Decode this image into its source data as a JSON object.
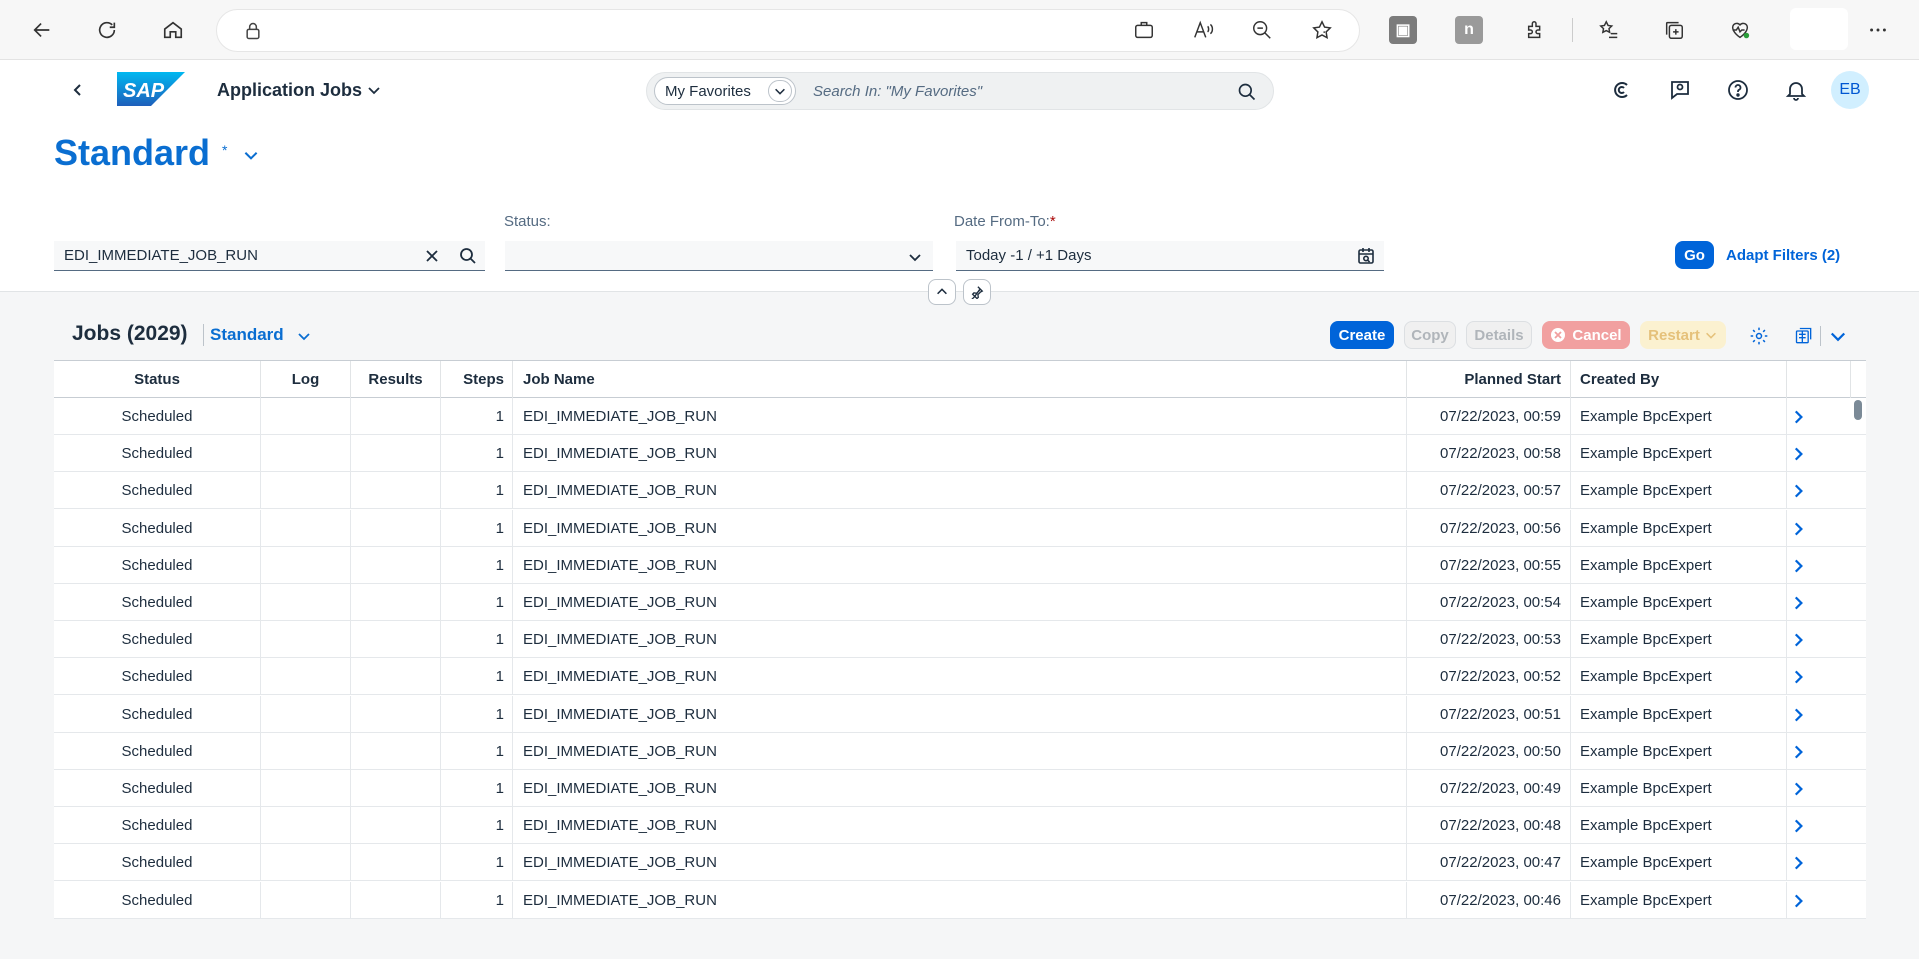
{
  "browser": {
    "addr_dot": "."
  },
  "shell": {
    "app_title": "Application Jobs",
    "search_scope": "My Favorites",
    "search_placeholder": "Search In: \"My Favorites\"",
    "avatar_initials": "EB"
  },
  "page": {
    "variant_title": "Standard",
    "variant_modified": "*"
  },
  "filters": {
    "job_search_value": "EDI_IMMEDIATE_JOB_RUN",
    "status_label": "Status:",
    "status_value": "",
    "date_label": "Date From-To:",
    "date_required_marker": "*",
    "date_value": "Today -1 / +1 Days",
    "go_label": "Go",
    "adapt_label": "Adapt Filters (2)"
  },
  "table": {
    "title": "Jobs (2029)",
    "variant": "Standard",
    "buttons": {
      "create": "Create",
      "copy": "Copy",
      "details": "Details",
      "cancel": "Cancel",
      "restart": "Restart"
    },
    "columns": [
      "Status",
      "Log",
      "Results",
      "Steps",
      "Job Name",
      "Planned Start",
      "Created By"
    ],
    "rows": [
      {
        "status": "Scheduled",
        "log": "",
        "results": "",
        "steps": "1",
        "job_name": "EDI_IMMEDIATE_JOB_RUN",
        "planned_start": "07/22/2023, 00:59",
        "created_by": "Example BpcExpert"
      },
      {
        "status": "Scheduled",
        "log": "",
        "results": "",
        "steps": "1",
        "job_name": "EDI_IMMEDIATE_JOB_RUN",
        "planned_start": "07/22/2023, 00:58",
        "created_by": "Example BpcExpert"
      },
      {
        "status": "Scheduled",
        "log": "",
        "results": "",
        "steps": "1",
        "job_name": "EDI_IMMEDIATE_JOB_RUN",
        "planned_start": "07/22/2023, 00:57",
        "created_by": "Example BpcExpert"
      },
      {
        "status": "Scheduled",
        "log": "",
        "results": "",
        "steps": "1",
        "job_name": "EDI_IMMEDIATE_JOB_RUN",
        "planned_start": "07/22/2023, 00:56",
        "created_by": "Example BpcExpert"
      },
      {
        "status": "Scheduled",
        "log": "",
        "results": "",
        "steps": "1",
        "job_name": "EDI_IMMEDIATE_JOB_RUN",
        "planned_start": "07/22/2023, 00:55",
        "created_by": "Example BpcExpert"
      },
      {
        "status": "Scheduled",
        "log": "",
        "results": "",
        "steps": "1",
        "job_name": "EDI_IMMEDIATE_JOB_RUN",
        "planned_start": "07/22/2023, 00:54",
        "created_by": "Example BpcExpert"
      },
      {
        "status": "Scheduled",
        "log": "",
        "results": "",
        "steps": "1",
        "job_name": "EDI_IMMEDIATE_JOB_RUN",
        "planned_start": "07/22/2023, 00:53",
        "created_by": "Example BpcExpert"
      },
      {
        "status": "Scheduled",
        "log": "",
        "results": "",
        "steps": "1",
        "job_name": "EDI_IMMEDIATE_JOB_RUN",
        "planned_start": "07/22/2023, 00:52",
        "created_by": "Example BpcExpert"
      },
      {
        "status": "Scheduled",
        "log": "",
        "results": "",
        "steps": "1",
        "job_name": "EDI_IMMEDIATE_JOB_RUN",
        "planned_start": "07/22/2023, 00:51",
        "created_by": "Example BpcExpert"
      },
      {
        "status": "Scheduled",
        "log": "",
        "results": "",
        "steps": "1",
        "job_name": "EDI_IMMEDIATE_JOB_RUN",
        "planned_start": "07/22/2023, 00:50",
        "created_by": "Example BpcExpert"
      },
      {
        "status": "Scheduled",
        "log": "",
        "results": "",
        "steps": "1",
        "job_name": "EDI_IMMEDIATE_JOB_RUN",
        "planned_start": "07/22/2023, 00:49",
        "created_by": "Example BpcExpert"
      },
      {
        "status": "Scheduled",
        "log": "",
        "results": "",
        "steps": "1",
        "job_name": "EDI_IMMEDIATE_JOB_RUN",
        "planned_start": "07/22/2023, 00:48",
        "created_by": "Example BpcExpert"
      },
      {
        "status": "Scheduled",
        "log": "",
        "results": "",
        "steps": "1",
        "job_name": "EDI_IMMEDIATE_JOB_RUN",
        "planned_start": "07/22/2023, 00:47",
        "created_by": "Example BpcExpert"
      },
      {
        "status": "Scheduled",
        "log": "",
        "results": "",
        "steps": "1",
        "job_name": "EDI_IMMEDIATE_JOB_RUN",
        "planned_start": "07/22/2023, 00:46",
        "created_by": "Example BpcExpert"
      }
    ]
  },
  "colors": {
    "brand_blue": "#0064d9",
    "title_blue": "#0a6ed1",
    "cancel_red": "#f1a0a0",
    "restart_yellow": "#fbf1d0"
  }
}
